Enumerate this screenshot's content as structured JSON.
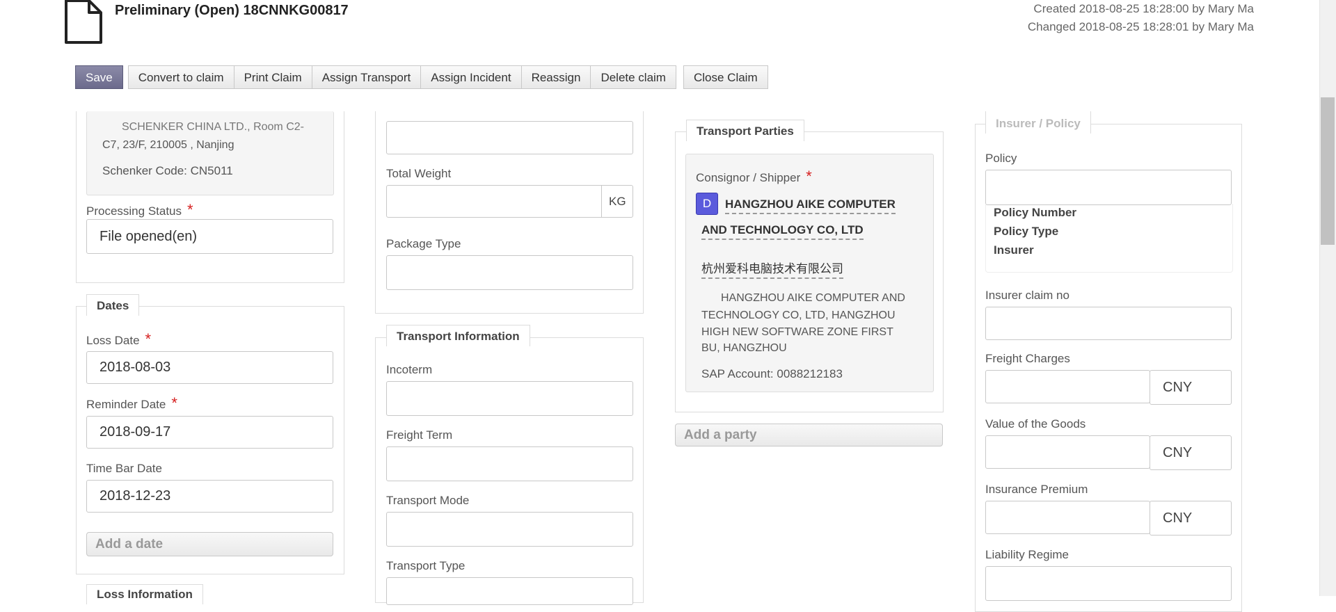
{
  "header": {
    "title": "Preliminary (Open) 18CNNKG00817",
    "created": "Created 2018-08-25 18:28:00 by Mary Ma",
    "changed": "Changed 2018-08-25 18:28:01 by Mary Ma"
  },
  "toolbar": {
    "save": "Save",
    "convert": "Convert to claim",
    "print": "Print Claim",
    "assign_transport": "Assign Transport",
    "assign_incident": "Assign Incident",
    "reassign": "Reassign",
    "delete": "Delete claim",
    "close": "Close Claim"
  },
  "col1": {
    "address_line1": "SCHENKER CHINA LTD., Room C2-",
    "address_line2": "C7, 23/F, 210005 , Nanjing",
    "schenker_code": "Schenker Code: CN5011",
    "processing_status_label": "Processing Status",
    "processing_status_value": "File opened(en)",
    "dates_legend": "Dates",
    "loss_date_label": "Loss Date",
    "loss_date_value": "2018-08-03",
    "reminder_date_label": "Reminder Date",
    "reminder_date_value": "2018-09-17",
    "time_bar_label": "Time Bar Date",
    "time_bar_value": "2018-12-23",
    "add_date": "Add a date",
    "loss_info_legend": "Loss Information"
  },
  "col2": {
    "total_weight_label": "Total Weight",
    "weight_unit": "KG",
    "package_type_label": "Package Type",
    "transport_info_legend": "Transport Information",
    "incoterm_label": "Incoterm",
    "freight_term_label": "Freight Term",
    "transport_mode_label": "Transport Mode",
    "transport_type_label": "Transport Type"
  },
  "col3": {
    "legend": "Transport Parties",
    "consignor_label": "Consignor / Shipper",
    "badge": "D",
    "company_line1": "HANGZHOU AIKE COMPUTER",
    "company_line2": "AND TECHNOLOGY CO, LTD",
    "company_cn": "杭州爱科电脑技术有限公司",
    "addr1": "HANGZHOU AIKE COMPUTER AND",
    "addr2": "TECHNOLOGY CO, LTD, HANGZHOU",
    "addr3": "HIGH NEW SOFTWARE ZONE FIRST",
    "addr4": "BU, HANGZHOU",
    "sap": "SAP Account: 0088212183",
    "add_party": "Add a party"
  },
  "col4": {
    "legend": "Insurer / Policy",
    "policy_label": "Policy",
    "policy_number": "Policy Number",
    "policy_type": "Policy Type",
    "insurer": "Insurer",
    "insurer_claim_label": "Insurer claim no",
    "freight_charges_label": "Freight Charges",
    "freight_currency": "CNY",
    "goods_value_label": "Value of the Goods",
    "goods_currency": "CNY",
    "premium_label": "Insurance Premium",
    "premium_currency": "CNY",
    "liability_label": "Liability Regime"
  },
  "colors": {
    "save_button": "#6c6b8c",
    "required_star": "#d62020",
    "badge": "#5b5bdc"
  }
}
